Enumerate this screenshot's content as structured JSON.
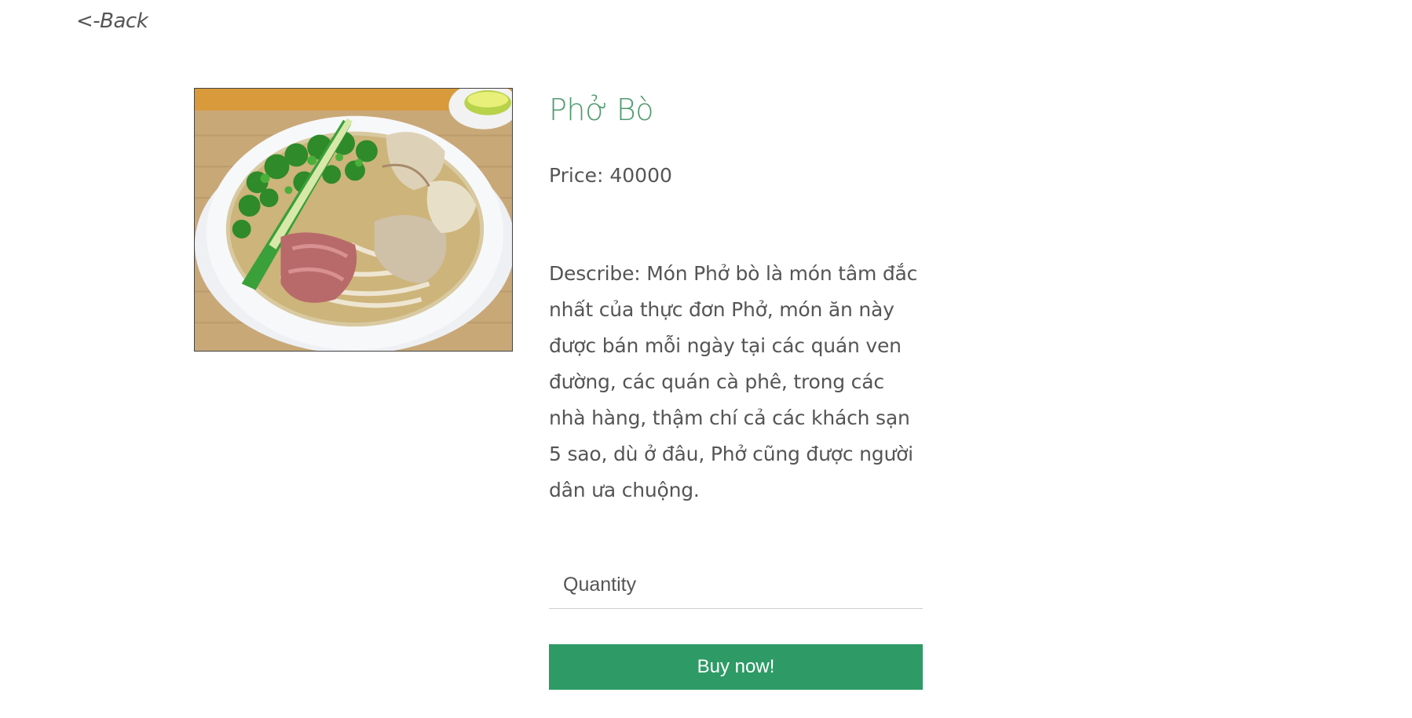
{
  "nav": {
    "back_label": "<-Back"
  },
  "product": {
    "name": "Phở Bò",
    "price_label": "Price: ",
    "price_value": "40000",
    "describe_label": "Describe: ",
    "description": "Món Phở bò là món tâm đắc nhất của thực đơn Phở, món ăn này được bán mỗi ngày tại các quán ven đường, các quán cà phê, trong các nhà hàng, thậm chí cả các khách sạn 5 sao, dù ở đâu, Phở cũng được người dân ưa chuộng."
  },
  "order": {
    "quantity_placeholder": "Quantity",
    "buy_label": "Buy now!"
  },
  "colors": {
    "title_green": "#4f9a6e",
    "button_green": "#2e9a66",
    "text_gray": "#555555"
  }
}
